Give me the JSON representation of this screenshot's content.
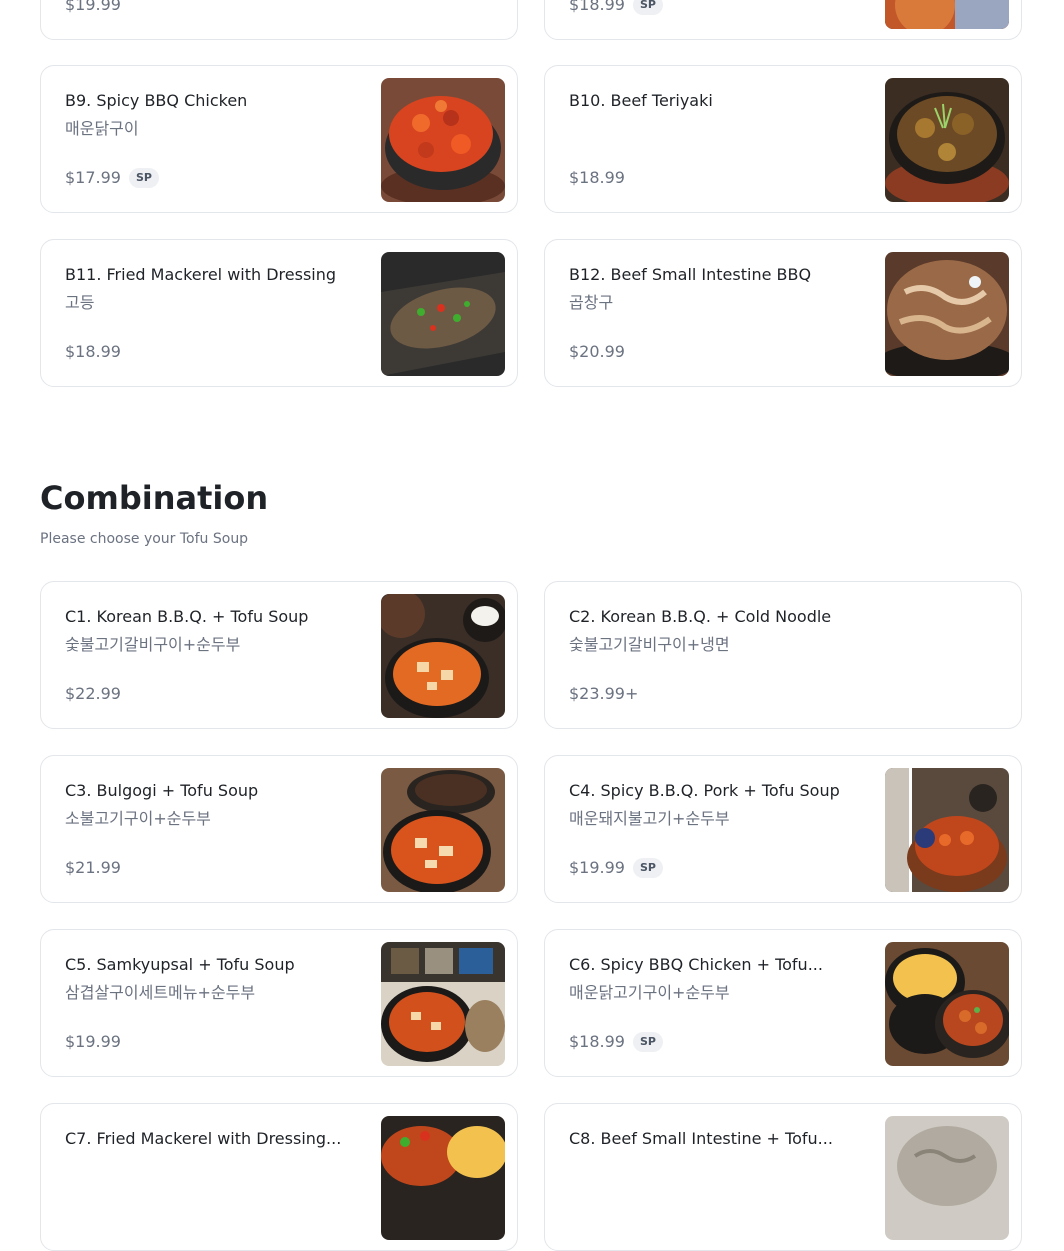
{
  "cards": {
    "b7": {
      "price": "$19.99"
    },
    "b8": {
      "price": "$18.99",
      "badge": "SP"
    },
    "b9": {
      "title": "B9. Spicy BBQ Chicken",
      "subtitle": "매운닭구이",
      "price": "$17.99",
      "badge": "SP"
    },
    "b10": {
      "title": "B10. Beef Teriyaki",
      "price": "$18.99"
    },
    "b11": {
      "title": "B11. Fried Mackerel with Dressing",
      "subtitle": "고등",
      "price": "$18.99"
    },
    "b12": {
      "title": "B12. Beef Small Intestine BBQ",
      "subtitle": "곱창구",
      "price": "$20.99"
    }
  },
  "combination": {
    "title": "Combination",
    "description": "Please choose your Tofu Soup",
    "items": [
      {
        "title": "C1. Korean B.B.Q. + Tofu Soup",
        "subtitle": "숯불고기갈비구이+순두부",
        "price": "$22.99"
      },
      {
        "title": "C2. Korean B.B.Q. + Cold Noodle",
        "subtitle": "숯불고기갈비구이+냉면",
        "price": "$23.99+"
      },
      {
        "title": "C3. Bulgogi + Tofu Soup",
        "subtitle": "소불고기구이+순두부",
        "price": "$21.99"
      },
      {
        "title": "C4. Spicy B.B.Q. Pork + Tofu Soup",
        "subtitle": "매운돼지불고기+순두부",
        "price": "$19.99",
        "badge": "SP"
      },
      {
        "title": "C5. Samkyupsal + Tofu Soup",
        "subtitle": "삼겹살구이세트메뉴+순두부",
        "price": "$19.99"
      },
      {
        "title": "C6. Spicy BBQ Chicken + Tofu...",
        "subtitle": "매운닭고기구이+순두부",
        "price": "$18.99",
        "badge": "SP"
      },
      {
        "title": "C7. Fried Mackerel with Dressing..."
      },
      {
        "title": "C8. Beef Small Intestine + Tofu..."
      }
    ]
  }
}
